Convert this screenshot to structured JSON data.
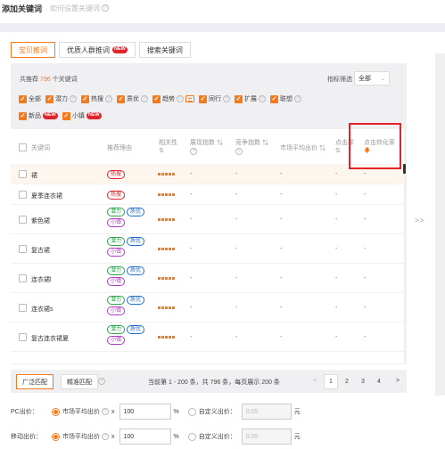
{
  "header": {
    "title": "添加关键词",
    "help_text": "如何设置关键词"
  },
  "tabs": [
    {
      "label": "宝贝推词",
      "active": true
    },
    {
      "label": "优质人群推词",
      "badge": "NEW"
    },
    {
      "label": "搜索关键词"
    }
  ],
  "summary": {
    "prefix": "共推荐",
    "count": "796",
    "suffix": "个关键词"
  },
  "filter": {
    "label": "指标筛选",
    "value": "全部"
  },
  "checkbox_rows": {
    "row1": [
      {
        "label": "全部",
        "help": false
      },
      {
        "label": "潜力",
        "help": true
      },
      {
        "label": "热搜",
        "help": true
      },
      {
        "label": "质优",
        "help": true
      },
      {
        "label": "趋势",
        "help": true,
        "image_icon": true
      },
      {
        "label": "同行",
        "help": true
      },
      {
        "label": "扩展",
        "help": true
      },
      {
        "label": "联想",
        "help": true
      }
    ],
    "row2": [
      {
        "label": "新品",
        "badge": "NEW"
      },
      {
        "label": "小镇",
        "badge": "NEW"
      }
    ]
  },
  "columns": {
    "keyword": "关键词",
    "reason": "推荐理由",
    "relevance": "相关性",
    "impressions": "展现指数",
    "competition": "竞争指数",
    "avg_bid": "市场平均出价",
    "ctr": "点击率",
    "cvr": "点击转化率"
  },
  "rows": [
    {
      "keyword": "裙",
      "tags": [
        {
          "text": "热搜",
          "kind": "hot"
        }
      ]
    },
    {
      "keyword": "夏季连衣裙",
      "tags": [
        {
          "text": "热搜",
          "kind": "hot"
        }
      ]
    },
    {
      "keyword": "紫色裙",
      "tags": [
        {
          "text": "潜力",
          "kind": "pot"
        },
        {
          "text": "质优",
          "kind": "prem"
        },
        {
          "text": "小镇",
          "kind": "niche"
        }
      ]
    },
    {
      "keyword": "复古裙",
      "tags": [
        {
          "text": "潜力",
          "kind": "pot"
        },
        {
          "text": "质优",
          "kind": "prem"
        },
        {
          "text": "小镇",
          "kind": "niche"
        }
      ]
    },
    {
      "keyword": "连衣裙l",
      "tags": [
        {
          "text": "潜力",
          "kind": "pot"
        },
        {
          "text": "质优",
          "kind": "prem"
        },
        {
          "text": "小镇",
          "kind": "niche"
        }
      ]
    },
    {
      "keyword": "连衣裙s",
      "tags": [
        {
          "text": "潜力",
          "kind": "pot"
        },
        {
          "text": "质优",
          "kind": "prem"
        },
        {
          "text": "小镇",
          "kind": "niche"
        }
      ]
    },
    {
      "keyword": "复古连衣裙夏",
      "tags": [
        {
          "text": "潜力",
          "kind": "pot"
        },
        {
          "text": "质优",
          "kind": "prem"
        },
        {
          "text": "小镇",
          "kind": "niche"
        }
      ]
    }
  ],
  "match_buttons": {
    "broad": "广泛匹配",
    "exact": "精准匹配"
  },
  "pager": {
    "info": "当前第 1 - 200 条，共 796 条，每页展示 200 条",
    "prev": "<",
    "pages": [
      "1",
      "2",
      "3",
      "4"
    ],
    "next": ">"
  },
  "expand_arrows": ">>",
  "bid": {
    "pc_label": "PC出价：",
    "mobile_label": "移动出价：",
    "market_option": "市场平均出价",
    "multiply": "x",
    "pc_value": "100",
    "mobile_value": "100",
    "percent": "%",
    "custom_option": "自定义出价：",
    "custom_placeholder": "0.05",
    "unit": "元"
  },
  "colors": {
    "accent": "#f57a1c",
    "highlight": "#e1242a"
  }
}
